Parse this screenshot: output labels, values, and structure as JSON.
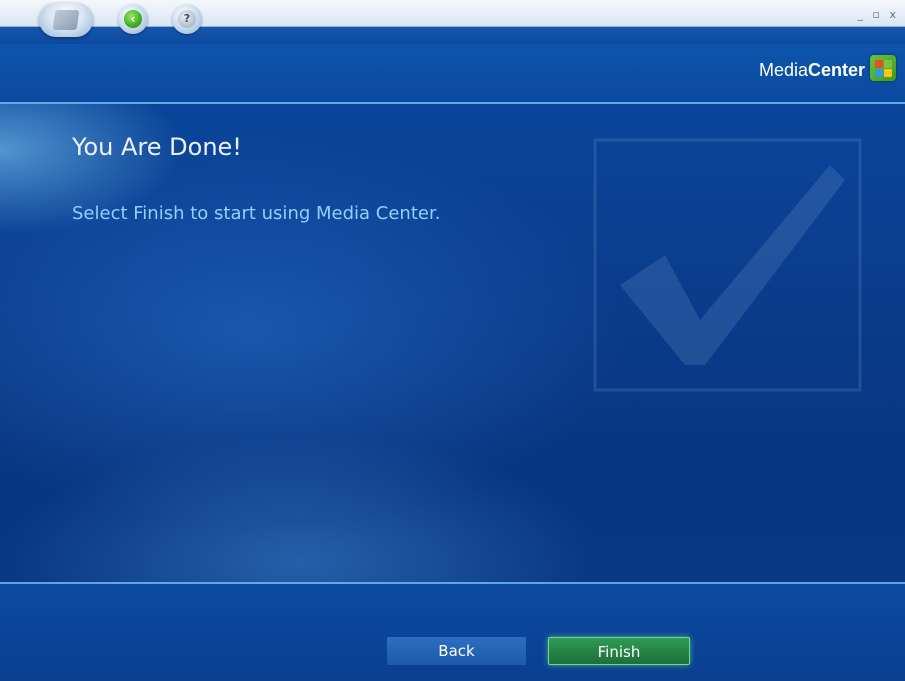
{
  "window": {
    "controls": "_ ▫ x"
  },
  "header": {
    "brand_light": "Media",
    "brand_bold": "Center"
  },
  "content": {
    "title": "You Are Done!",
    "subtitle": "Select Finish to start using Media Center."
  },
  "buttons": {
    "back": "Back",
    "finish": "Finish"
  },
  "icons": {
    "start": "windows-flag-icon",
    "back": "back-arrow-icon",
    "help": "help-icon",
    "logo": "windows-logo-icon",
    "watermark": "checkmark-icon"
  },
  "colors": {
    "background": "#0a3f8c",
    "title": "#eaf3ff",
    "subtitle": "#8fd1ff",
    "finish_accent": "#2f9a53"
  }
}
